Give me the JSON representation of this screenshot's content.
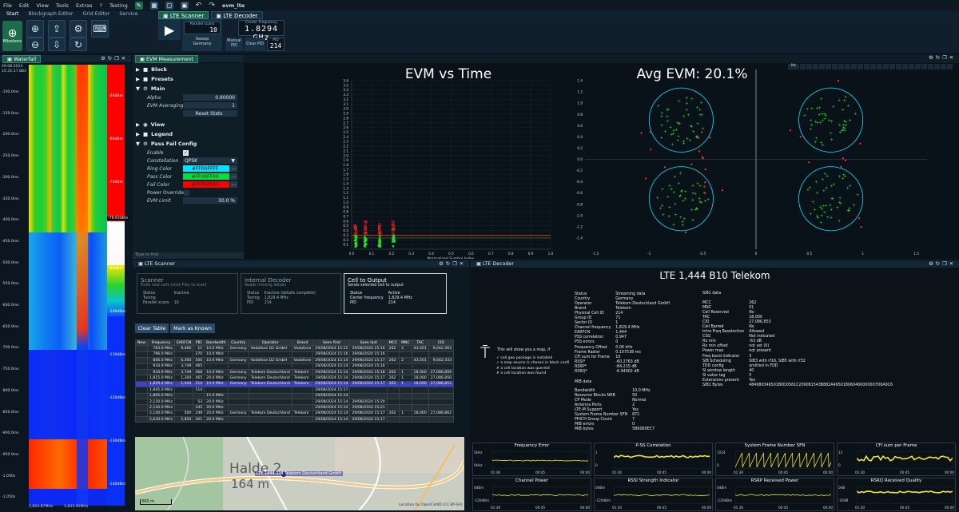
{
  "menubar": {
    "items": [
      "File",
      "Edit",
      "View",
      "Tools",
      "Extras",
      "?",
      "Testing"
    ],
    "title": "evm_lte"
  },
  "ribbon_tabs": [
    "Start",
    "Blockgraph Editor",
    "Grid Editor",
    "Service"
  ],
  "missions_label": "Missions",
  "doc_tabs": {
    "scanner": "LTE Scanner",
    "decoder": "LTE Decoder"
  },
  "scanner_ribbon": {
    "sweep_label": "Sweep",
    "sweep_value": "Germany",
    "parallel_label": "Parallel scans",
    "parallel_value": "10",
    "cf_label": "Center Frequency",
    "cf_value": "1.8294 GHz",
    "manual_pid": "Manual\nPID",
    "clear_pid": "Clear PID",
    "pid_label": "PID",
    "pid_value": "214"
  },
  "waterfall": {
    "tab": "Waterfall",
    "date": "29.08.2024",
    "time": "15:31:17.883",
    "time_labels": [
      "-100.0ms",
      "-150.0ms",
      "-200.0ms",
      "-250.0ms",
      "-300.0ms",
      "-350.0ms",
      "-400.0ms",
      "-450.0ms",
      "-500.0ms",
      "-550.0ms",
      "-600.0ms",
      "-650.0ms",
      "-700.0ms",
      "-750.0ms",
      "-800.0ms",
      "-850.0ms",
      "-900.0ms",
      "-950.0ms",
      "-1.000s",
      "-1.050s"
    ],
    "spectrum_labels": [
      "-50dBm",
      "-60dBm",
      "-70dBm",
      "-80dBm",
      "-90dBm",
      "-100dBm",
      "-110dBm",
      "-120dBm",
      "-130dBm",
      "-140dBm"
    ],
    "marker": "-78.63dBm",
    "f_start": "1,824.87MHz",
    "f_end": "1,833.91MHz"
  },
  "evm_panel": {
    "tab": "EVM Measurement",
    "sections": {
      "block": "Block",
      "presets": "Presets",
      "main": "Main",
      "view": "View",
      "legend": "Legend",
      "passfail": "Pass Fail Config"
    },
    "alpha_label": "Alpha",
    "alpha_value": "0.90000",
    "avg_label": "EVM Averaging",
    "avg_value": "1",
    "reset": "Reset Stats",
    "enable_label": "Enable",
    "const_label": "Constellation",
    "const_value": "QPSK",
    "ring_label": "Ring Color",
    "ring_value": "#FF00FFFF",
    "pass_label": "Pass Color",
    "pass_value": "#FF00FF00",
    "fail_label": "Fail Color",
    "fail_value": "#FFFF0000",
    "override_label": "Power Override",
    "limit_label": "EVM Limit",
    "limit_value": "30.0 %",
    "filter": "Type to find"
  },
  "evm_chart": {
    "title": "EVM vs Time",
    "xlabel": "Normalized Symbol Index",
    "toolbar_label": "Ms"
  },
  "chart_data": [
    {
      "type": "scatter",
      "title": "EVM vs Time",
      "xlabel": "Normalized Symbol Index",
      "ylabel": "",
      "xlim": [
        0,
        1
      ],
      "ylim": [
        0,
        3.6
      ],
      "xticks": [
        "0.0",
        "0.1",
        "0.2",
        "0.3",
        "0.4",
        "0.5",
        "0.6",
        "0.7",
        "0.8",
        "0.9",
        "1.0"
      ],
      "yticks": [
        "0.1",
        "0.2",
        "0.3",
        "0.4",
        "0.5",
        "0.6",
        "0.7",
        "0.8",
        "0.9",
        "1.0",
        "1.1",
        "1.2",
        "1.3",
        "1.4",
        "1.5",
        "1.6",
        "1.7",
        "1.8",
        "1.9",
        "2.0",
        "2.1",
        "2.2",
        "2.3",
        "2.4",
        "2.5",
        "2.6",
        "2.7",
        "2.8",
        "2.9",
        "3.0",
        "3.1",
        "3.2",
        "3.3",
        "3.4",
        "3.5",
        "3.6"
      ],
      "limit": 0.3,
      "pass_columns": [
        0.02,
        0.07,
        0.14,
        0.21
      ],
      "pass_range": [
        0.05,
        0.3
      ],
      "fail_columns": [
        0.02,
        0.07,
        0.14,
        0.21
      ],
      "fail_range": [
        0.3,
        0.6
      ]
    },
    {
      "type": "scatter",
      "title": "Avg EVM: 20.1%",
      "xlim": [
        -1.6,
        1.6
      ],
      "ylim": [
        -1.6,
        1.6
      ],
      "xticks": [
        "-1.5",
        "-1",
        "-0.5",
        "0",
        "0.5",
        "1",
        "1.5"
      ],
      "yticks": [
        "-1.4",
        "-1.2",
        "-1.0",
        "-0.8",
        "-0.6",
        "-0.4",
        "-0.2",
        "0.0",
        "0.2",
        "0.4",
        "0.6",
        "0.8",
        "1.0",
        "1.2",
        "1.4"
      ],
      "clusters": [
        [
          -0.7,
          0.7
        ],
        [
          0.7,
          0.7
        ],
        [
          -0.7,
          -0.7
        ],
        [
          0.7,
          -0.7
        ]
      ],
      "ring_radius": 0.3,
      "avg_evm_percent": 20.1
    }
  ],
  "scanner_panel": {
    "tab": "LTE Scanner",
    "scanner": {
      "title": "Scanner",
      "subtitle": "Finds new cells (click Play to scan)",
      "rows": [
        [
          "Status",
          "Inactive"
        ],
        [
          "Tuning",
          ""
        ],
        [
          "Parallel scans",
          "10"
        ]
      ]
    },
    "internal": {
      "title": "Internal Decoder",
      "subtitle": "Reads missing details",
      "rows": [
        [
          "Status",
          "Inactive (details complete)"
        ],
        [
          "Tuning",
          "1,829.4 MHz"
        ],
        [
          "PID",
          "214"
        ]
      ]
    },
    "output": {
      "title": "Cell to Output",
      "subtitle": "Sends selected cell to output",
      "rows": [
        [
          "Status",
          "Active"
        ],
        [
          "Center frequency",
          "1,829.4 MHz"
        ],
        [
          "PID",
          "214"
        ]
      ]
    },
    "clear_table": "Clear Table",
    "mark_known": "Mark as Known",
    "columns": [
      "New",
      "Frequency",
      "EARFCN",
      "PID",
      "Bandwidth",
      "Country",
      "Operator",
      "Brand",
      "Seen first",
      "Seen last",
      "MCC",
      "MNC",
      "TAC",
      "CID"
    ],
    "rows": [
      [
        "",
        "783.0 MHz",
        "9,460",
        "11",
        "10.0 MHz",
        "Germany",
        "Vodafone D2 GmbH",
        "Vodafone",
        "29/08/2024 15:15",
        "29/08/2024 15:16",
        "262",
        "2",
        "43,501",
        "9,042,463"
      ],
      [
        "",
        "796.0 MHz",
        "",
        "270",
        "10.0 MHz",
        "",
        "",
        "",
        "29/08/2024 15:16",
        "29/08/2024 15:16",
        "",
        "",
        "",
        ""
      ],
      [
        "",
        "806.0 MHz",
        "6,300",
        "500",
        "10.0 MHz",
        "Germany",
        "Vodafone D2 GmbH",
        "Vodafone",
        "29/08/2024 15:14",
        "29/08/2024 15:17",
        "262",
        "2",
        "43,501",
        "9,042,433"
      ],
      [
        "",
        "934.9 MHz",
        "3,749",
        "465",
        "",
        "",
        "",
        "",
        "29/08/2024 15:14",
        "29/08/2024 15:16",
        "",
        "",
        "",
        ""
      ],
      [
        "",
        "934.9 MHz",
        "3,749",
        "468",
        "10.0 MHz",
        "Germany",
        "Telekom Deutschland",
        "Telekom",
        "29/08/2024 15:14",
        "29/08/2024 15:18",
        "262",
        "1",
        "18,000",
        "27,086,859"
      ],
      [
        "",
        "1,815.0 MHz",
        "1,300",
        "465",
        "20.0 MHz",
        "Germany",
        "Telekom Deutschland",
        "Telekom",
        "29/08/2024 15:14",
        "29/08/2024 15:17",
        "262",
        "1",
        "18,000",
        "27,086,850"
      ],
      [
        "",
        "1,829.4 MHz",
        "1,444",
        "214",
        "10.0 MHz",
        "Germany",
        "Telekom Deutschland",
        "Telekom",
        "29/08/2024 15:14",
        "29/08/2024 15:17",
        "262",
        "1",
        "18,000",
        "27,086,853"
      ],
      [
        "",
        "1,845.0 MHz",
        "",
        "114",
        "",
        "",
        "",
        "",
        "29/08/2024 15:17",
        "",
        "",
        "",
        "",
        ""
      ],
      [
        "",
        "1,865.0 MHz",
        "",
        "",
        "15.0 MHz",
        "",
        "",
        "",
        "29/08/2024 15:14",
        "",
        "",
        "",
        "",
        ""
      ],
      [
        "",
        "2,120.0 MHz",
        "",
        "53",
        "20.0 MHz",
        "",
        "",
        "",
        "29/08/2024 15:14",
        "29/08/2024 15:20",
        "",
        "",
        "",
        ""
      ],
      [
        "",
        "2,140.0 MHz",
        "",
        "345",
        "20.0 MHz",
        "",
        "",
        "",
        "29/08/2024 15:14",
        "29/08/2024 15:21",
        "",
        "",
        "",
        ""
      ],
      [
        "",
        "2,140.0 MHz",
        "500",
        "249",
        "20.0 MHz",
        "Germany",
        "Telekom Deutschland",
        "Telekom",
        "29/08/2024 15:14",
        "29/08/2024 15:17",
        "262",
        "1",
        "18,000",
        "27,086,862"
      ],
      [
        "",
        "2,630.0 MHz",
        "2,850",
        "301",
        "20.0 MHz",
        "",
        "",
        "",
        "29/08/2024 15:14",
        "29/08/2024 15:17",
        "",
        "",
        "",
        ""
      ]
    ],
    "selected_row": 6,
    "map": {
      "place": "Halde 2",
      "elev": "164 m",
      "cell_label": "LTE 1444 214 Telekom Deutschland GmbH",
      "scale": "300 m",
      "credit": "Location by OpenCellID (CC-BY-SA)"
    }
  },
  "decoder_panel": {
    "tab": "LTE Decoder",
    "title": "LTE 1,444  B10  Telekom",
    "map_info": "This will show you a map, if",
    "map_checks": [
      "cell geo package is installed",
      "a map source is chosen in block confi",
      "a cell location was queried",
      "a cell location was found"
    ],
    "main_rows": [
      [
        "Status",
        "Streaming data"
      ],
      [
        "Country",
        "Germany"
      ],
      [
        "Operator",
        "Telekom Deutschland GmbH"
      ],
      [
        "Brand",
        "Telekom"
      ],
      [
        "Physical Cell ID",
        "214"
      ],
      [
        "Group ID",
        "71"
      ],
      [
        "Sector ID",
        "1"
      ],
      [
        "Channel frequency",
        "1,829.4 MHz"
      ],
      [
        "EARFCN",
        "1,444"
      ],
      [
        "PSS correlation",
        "0.947"
      ],
      [
        "PSS errors",
        "0"
      ],
      [
        "Frequency Offset",
        "0.06 kHz"
      ],
      [
        "Frame Raster",
        "0.107538 ms"
      ],
      [
        "CFI sum for Frame",
        "10"
      ],
      [
        "RSSI*",
        "-60.2763 dB"
      ],
      [
        "RSRP*",
        "-84.215 dB"
      ],
      [
        "RSRQ*",
        "-6.94902 dB"
      ]
    ],
    "mib_title": "MIB data",
    "mib_rows": [
      [
        "Bandwidth",
        "10.0 MHz"
      ],
      [
        "Resource Blocks NRB",
        "50"
      ],
      [
        "CP Mode",
        "Normal"
      ],
      [
        "Antenna Ports",
        "2"
      ],
      [
        "LTE-M Support",
        "Yes"
      ],
      [
        "System Frame Number SFN",
        "872"
      ],
      [
        "PHICH Group Count",
        "7"
      ],
      [
        "MIB errors",
        "0"
      ],
      [
        "MIB bytes",
        "5B6080EC7"
      ]
    ],
    "sib_title": "SIB1 data",
    "sib_rows": [
      [
        "MCC",
        "262"
      ],
      [
        "MNC",
        "01"
      ],
      [
        "Cell Reserved",
        "No"
      ],
      [
        "TAC",
        "18,000"
      ],
      [
        "CID",
        "27,086,853"
      ],
      [
        "Cell Barred",
        "No"
      ],
      [
        "Intra Freq Reselection",
        "Allowed"
      ],
      [
        "CSG",
        "Not indicated"
      ],
      [
        "Rx min",
        "-63 dB"
      ],
      [
        "Rx min offset",
        "not set (0)"
      ],
      [
        "Power max",
        "not present"
      ],
      [
        "Freq band indicator",
        "3"
      ],
      [
        "SIB Scheduling",
        "SIB3 with rf16, SIB5 with rf32"
      ],
      [
        "TDD config",
        "omitted in FDD"
      ],
      [
        "SI window length",
        "40"
      ],
      [
        "SI value tag",
        "5"
      ],
      [
        "Extensions present",
        "Yes"
      ],
      [
        "SIB1 Bytes",
        "484980346501B0D0581C209081543B882A495018060400000007D0A9C6"
      ]
    ],
    "minis": [
      {
        "title": "Frequency Error",
        "y": [
          "5kHz",
          "0kHz"
        ],
        "x": [
          "01:30",
          "00:45",
          "00:00"
        ]
      },
      {
        "title": "P-SS Correlation",
        "y": [
          "1",
          "0"
        ],
        "x": [
          "01:30",
          "00:45",
          "00:00"
        ]
      },
      {
        "title": "System Frame Number SFN",
        "y": [
          "1024",
          "0"
        ],
        "x": [
          "01:30",
          "00:45",
          "00:00"
        ]
      },
      {
        "title": "CFI sum per Frame",
        "y": [
          "12",
          "0"
        ],
        "x": [
          "01:30",
          "00:45",
          "00:00"
        ]
      },
      {
        "title": "Channel Power",
        "y": [
          "0dBm",
          "-120dBm"
        ],
        "x": [
          "01:30",
          "00:45",
          "00:00"
        ]
      },
      {
        "title": "RSSI Strength Indicator",
        "y": [
          "0dBm",
          "-120dBm"
        ],
        "x": [
          "01:30",
          "00:45",
          "00:00"
        ]
      },
      {
        "title": "RSRP Received Power",
        "y": [
          "0dBm",
          "-120dBm"
        ],
        "x": [
          "01:30",
          "00:45",
          "00:00"
        ]
      },
      {
        "title": "RSRQ Received Quality",
        "y": [
          "0dB",
          "-20dB"
        ],
        "x": [
          "01:30",
          "00:45",
          "00:00"
        ]
      }
    ]
  }
}
